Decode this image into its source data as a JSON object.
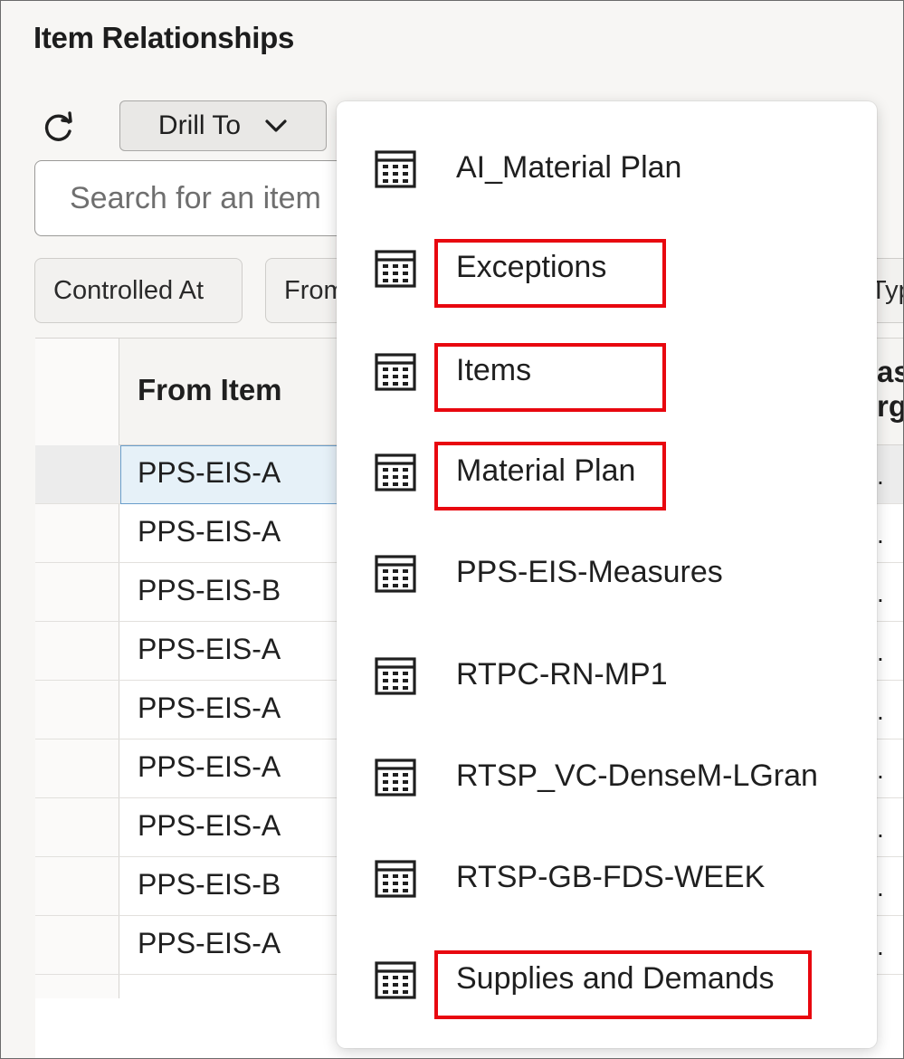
{
  "page": {
    "title": "Item Relationships"
  },
  "toolbar": {
    "drill_label": "Drill To"
  },
  "search": {
    "placeholder": "Search for an item"
  },
  "filters": {
    "controlled_at": "Controlled At",
    "from": "From",
    "type": "Type"
  },
  "table": {
    "header_from": "From Item",
    "header_right": "as\nrga",
    "rows": [
      {
        "from_item": "PPS-EIS-A",
        "right": "."
      },
      {
        "from_item": "PPS-EIS-A",
        "right": "."
      },
      {
        "from_item": "PPS-EIS-B",
        "right": "."
      },
      {
        "from_item": "PPS-EIS-A",
        "right": "."
      },
      {
        "from_item": "PPS-EIS-A",
        "right": "."
      },
      {
        "from_item": "PPS-EIS-A",
        "right": "."
      },
      {
        "from_item": "PPS-EIS-A",
        "right": "."
      },
      {
        "from_item": "PPS-EIS-B",
        "right": "."
      },
      {
        "from_item": "PPS-EIS-A",
        "right": "."
      }
    ]
  },
  "menu": {
    "items": [
      {
        "label": "AI_Material Plan",
        "highlighted": false
      },
      {
        "label": "Exceptions",
        "highlighted": true
      },
      {
        "label": "Items",
        "highlighted": true
      },
      {
        "label": "Material Plan",
        "highlighted": true
      },
      {
        "label": "PPS-EIS-Measures",
        "highlighted": false
      },
      {
        "label": "RTPC-RN-MP1",
        "highlighted": false
      },
      {
        "label": "RTSP_VC-DenseM-LGran",
        "highlighted": false
      },
      {
        "label": "RTSP-GB-FDS-WEEK",
        "highlighted": false
      },
      {
        "label": "Supplies and Demands",
        "highlighted": true
      }
    ]
  },
  "colors": {
    "highlight_box": "#e8070f",
    "selected_row_fill": "#e6f1f8",
    "selected_row_border": "#6a9ecb"
  },
  "icons": {
    "refresh": "refresh-icon",
    "drill_chevron": "chevron-down-icon",
    "menu_item": "table-grid-icon"
  }
}
